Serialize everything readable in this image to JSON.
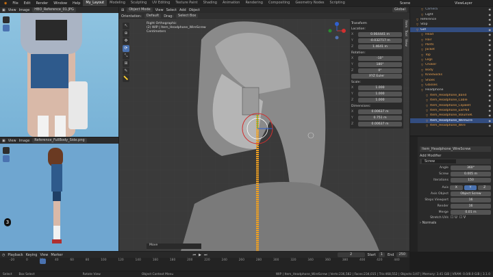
{
  "menu": [
    "File",
    "Edit",
    "Render",
    "Window",
    "Help"
  ],
  "workspaces": [
    "Layout",
    "Modeling",
    "Sculpting",
    "UV Editing",
    "Texture Paint",
    "Shading",
    "Animation",
    "Rendering",
    "Compositing",
    "Geometry Nodes",
    "Scripting"
  ],
  "active_workspace": "My_Layout",
  "scene": {
    "label": "Scene",
    "view_layer": "ViewLayer"
  },
  "image_editor_top": {
    "view": "View",
    "image": "Image",
    "file": "HBO_Reference_01.JPG"
  },
  "image_editor_bottom": {
    "view": "View",
    "image": "Image",
    "file": "Reference_FullBody_Side.png",
    "badge": "3"
  },
  "viewport": {
    "mode": "Object Mode",
    "menus": [
      "View",
      "Select",
      "Add",
      "Object"
    ],
    "orientation_label": "Orientation:",
    "orientation": "Default",
    "drag_label": "Drag:",
    "drag": "Select Box",
    "transform": "Global",
    "info_line1": "Right Orthographic",
    "info_line2": "(2) WIP | Item_Headphone_WireScrew",
    "info_line3": "Centimeters",
    "status_move": "Move"
  },
  "npanel": {
    "tabs": [
      "Item",
      "Tool",
      "View"
    ],
    "transform_title": "Transform",
    "location_label": "Location:",
    "location": [
      {
        "axis": "X",
        "value": "0.064441 m"
      },
      {
        "axis": "Y",
        "value": "-0.032717 m"
      },
      {
        "axis": "Z",
        "value": "1.4641 m"
      }
    ],
    "rotation_label": "Rotation:",
    "rotation": [
      {
        "axis": "X",
        "value": "-10°"
      },
      {
        "axis": "Y",
        "value": "180°"
      },
      {
        "axis": "Z",
        "value": "0°"
      }
    ],
    "rotation_mode": "XYZ Euler",
    "scale_label": "Scale:",
    "scale": [
      {
        "axis": "X",
        "value": "1.000"
      },
      {
        "axis": "Y",
        "value": "1.000"
      },
      {
        "axis": "Z",
        "value": "1.000"
      }
    ],
    "dimensions_label": "Dimensions:",
    "dimensions": [
      {
        "axis": "X",
        "value": "0.00637 m"
      },
      {
        "axis": "Y",
        "value": "0.751 m"
      },
      {
        "axis": "Z",
        "value": "0.00637 m"
      }
    ]
  },
  "outliner": {
    "items": [
      {
        "name": "Camera",
        "indent": 2,
        "color": "#8fa0b8"
      },
      {
        "name": "Light",
        "indent": 2,
        "color": "#c8c8c8"
      },
      {
        "name": "Reference",
        "indent": 1,
        "color": "#c8c8c8"
      },
      {
        "name": "Stop",
        "indent": 1,
        "color": "#c8c8c8"
      },
      {
        "name": "Girl",
        "indent": 1,
        "color": "#ffffff",
        "sel": true
      },
      {
        "name": "Head",
        "indent": 2,
        "color": "#e8a050"
      },
      {
        "name": "Hair",
        "indent": 2,
        "color": "#e8a050"
      },
      {
        "name": "Pants",
        "indent": 2,
        "color": "#e8a050"
      },
      {
        "name": "Jacket",
        "indent": 2,
        "color": "#e8a050"
      },
      {
        "name": "Top",
        "indent": 2,
        "color": "#e8a050"
      },
      {
        "name": "Legs",
        "indent": 2,
        "color": "#e8a050"
      },
      {
        "name": "Choker",
        "indent": 2,
        "color": "#e8a050"
      },
      {
        "name": "Body",
        "indent": 2,
        "color": "#e8a050"
      },
      {
        "name": "KneeSocks",
        "indent": 2,
        "color": "#e8a050"
      },
      {
        "name": "Shoes",
        "indent": 2,
        "color": "#e8a050"
      },
      {
        "name": "Glasses",
        "indent": 2,
        "color": "#e8a050"
      },
      {
        "name": "Headphone",
        "indent": 2,
        "color": "#c8c8c8"
      },
      {
        "name": "Item_Headphone_Band",
        "indent": 3,
        "color": "#e8a050"
      },
      {
        "name": "Item_Headphone_Cable",
        "indent": 3,
        "color": "#e8a050"
      },
      {
        "name": "Item_Headphone_ClipBelt",
        "indent": 3,
        "color": "#e8a050"
      },
      {
        "name": "Item_Headphone_EarPad",
        "indent": 3,
        "color": "#e8a050"
      },
      {
        "name": "Item_Headphone_VolumeK",
        "indent": 3,
        "color": "#e8a050"
      },
      {
        "name": "Item_Headphone_WireScre",
        "indent": 3,
        "color": "#ffffff",
        "sel": true
      },
      {
        "name": "Item_Headphone_Wire",
        "indent": 3,
        "color": "#e8a050"
      }
    ]
  },
  "properties": {
    "object_name": "Item_Headphone_WireScrew",
    "modifier_tab": "Screw",
    "add_modifier": "Add Modifier",
    "modifier_name": "Screw",
    "angle_label": "Angle",
    "angle": "360°",
    "screw_label": "Screw",
    "screw": "0.005 m",
    "iterations_label": "Iterations",
    "iterations": "150",
    "axis_label": "Axis",
    "axes": [
      "X",
      "Y",
      "Z"
    ],
    "axis_object_label": "Axis Object",
    "axis_object_placeholder": "Object Screw",
    "steps_viewport_label": "Steps Viewport",
    "steps_viewport": "16",
    "render_label": "Render",
    "render": "16",
    "merge_label": "Merge",
    "merge_value": "0.01 m",
    "stretch_label": "Stretch UVs",
    "stretch_u": "U",
    "stretch_v": "V",
    "normals_label": "Normals"
  },
  "timeline": {
    "menus": [
      "Playback",
      "Keying",
      "View",
      "Marker"
    ],
    "current_frame": "2",
    "start_label": "Start",
    "start": "1",
    "end_label": "End",
    "end": "250",
    "ticks": [
      "-20",
      "0",
      "20",
      "40",
      "60",
      "80",
      "100",
      "120",
      "140",
      "160",
      "180",
      "200",
      "220",
      "240",
      "260",
      "280",
      "300",
      "320",
      "340",
      "360",
      "380",
      "400",
      "420",
      "440"
    ]
  },
  "statusbar": {
    "select": "Select",
    "box": "Box Select",
    "rotate": "Rotate View",
    "context": "Object Context Menu",
    "stats": "WIP | Item_Headphone_WireScrew | Verts:236,582 | Faces:234,015 | Tris:468,552 | Objects:1/47 | Memory: 3.41 GiB | VRAM: 0.0/8.0 GiB | 3.1.0"
  }
}
